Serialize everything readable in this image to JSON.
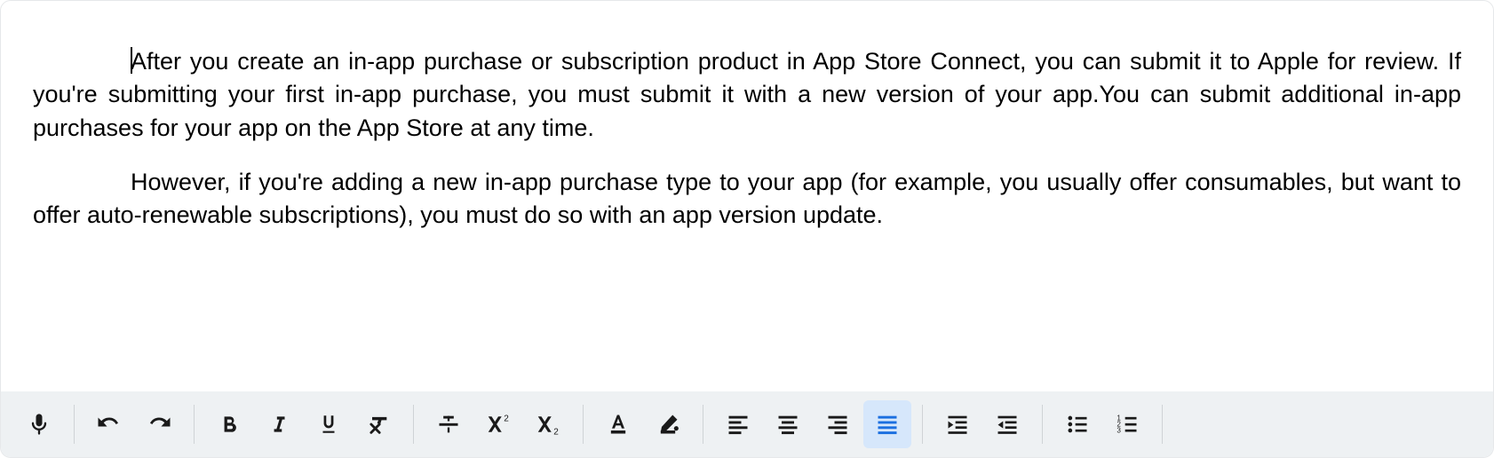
{
  "editor": {
    "paragraphs": [
      "After you create an in-app purchase or subscription product in App Store Connect, you can submit it to Apple for review. If you're submitting your first in-app purchase, you must submit it with a new version of your app.You can submit additional in-app purchases for your app on the App Store at any time.",
      "However, if you're adding a new in-app purchase type to your app (for example, you usually offer consumables, but want to offer auto-renewable subscriptions), you must do so with an app version update."
    ]
  },
  "toolbar": {
    "buttons": {
      "mic": "Dictate",
      "undo": "Undo",
      "redo": "Redo",
      "bold": "Bold",
      "italic": "Italic",
      "underline": "Underline",
      "clear_format": "Clear formatting",
      "strike": "Strikethrough",
      "superscript": "Superscript",
      "subscript": "Subscript",
      "text_color": "Text color",
      "highlight": "Highlight color",
      "align_left": "Align left",
      "align_center": "Align center",
      "align_right": "Align right",
      "align_justify": "Justify",
      "indent_increase": "Increase indent",
      "indent_decrease": "Decrease indent",
      "bullet_list": "Bulleted list",
      "number_list": "Numbered list"
    },
    "active": "align_justify"
  },
  "colors": {
    "toolbar_bg": "#eef1f3",
    "active_bg": "#d6e7fb",
    "active_fg": "#1b6fe0",
    "icon": "#1a1a1a"
  }
}
